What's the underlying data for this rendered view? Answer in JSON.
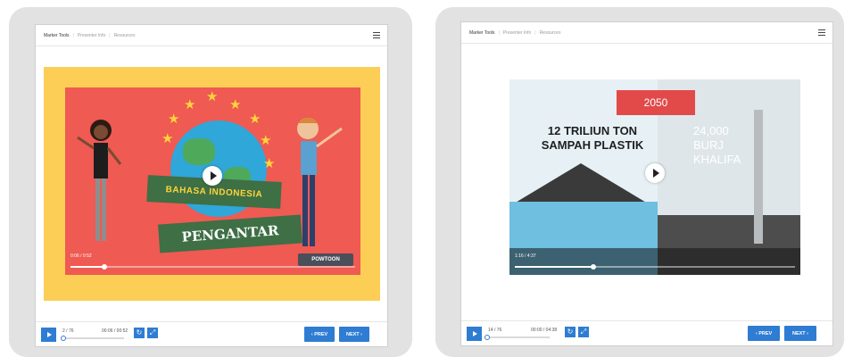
{
  "left_panel": {
    "tabs": [
      "Marker Tools",
      "Presenter Info",
      "Resources"
    ],
    "video": {
      "banner_top": "BAHASA INDONESIA",
      "banner_bottom": "PENGANTAR",
      "time": "0:06 / 0:52",
      "progress": 0.12,
      "watermark": "POWTOON"
    },
    "controls": {
      "slide_count": "2 / 76",
      "time": "00:06 / 00:52",
      "slide_progress": 0.03,
      "prev_label": "‹ PREV",
      "next_label": "NEXT ›"
    }
  },
  "right_panel": {
    "tabs": [
      "Marker Tools",
      "Presenter Info",
      "Resources"
    ],
    "video": {
      "year": "2050",
      "left_text_line1": "12 TRILIUN TON",
      "left_text_line2": "SAMPAH PLASTIK",
      "right_text_line1": "24,000",
      "right_text_line2": "BURJ",
      "right_text_line3": "KHALIFA",
      "time": "1:16 / 4:37",
      "progress": 0.28
    },
    "controls": {
      "slide_count": "14 / 76",
      "time": "00:00 / 04:38",
      "slide_progress": 0.0,
      "prev_label": "‹ PREV",
      "next_label": "NEXT ›"
    }
  },
  "colors": {
    "accent": "#2f7cd3",
    "frame_yellow": "#fdce55",
    "video_red": "#ef5a52",
    "year_badge": "#e24a4a"
  }
}
